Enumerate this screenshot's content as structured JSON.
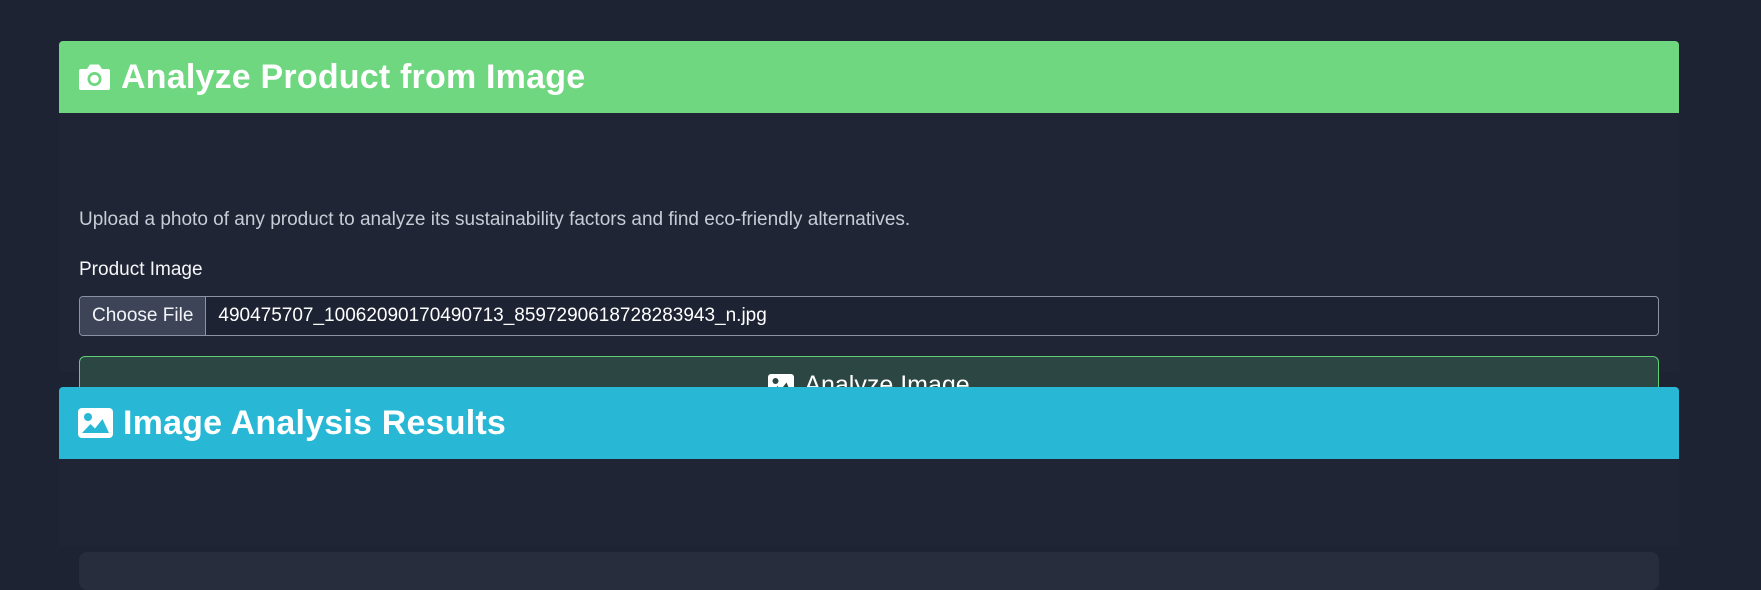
{
  "upload_card": {
    "title": "Analyze Product from Image",
    "icon": "camera-icon",
    "header_color": "#6ed77f",
    "description": "Upload a photo of any product to analyze its sustainability factors and find eco-friendly alternatives.",
    "field_label": "Product Image",
    "choose_file_label": "Choose File",
    "file_name": "490475707_10062090170490713_8597290618728283943_n.jpg",
    "analyze_button_label": "Analyze Image",
    "analyze_button_icon": "image-icon"
  },
  "results_card": {
    "title": "Image Analysis Results",
    "icon": "image-icon",
    "header_color": "#28b8d6"
  }
}
